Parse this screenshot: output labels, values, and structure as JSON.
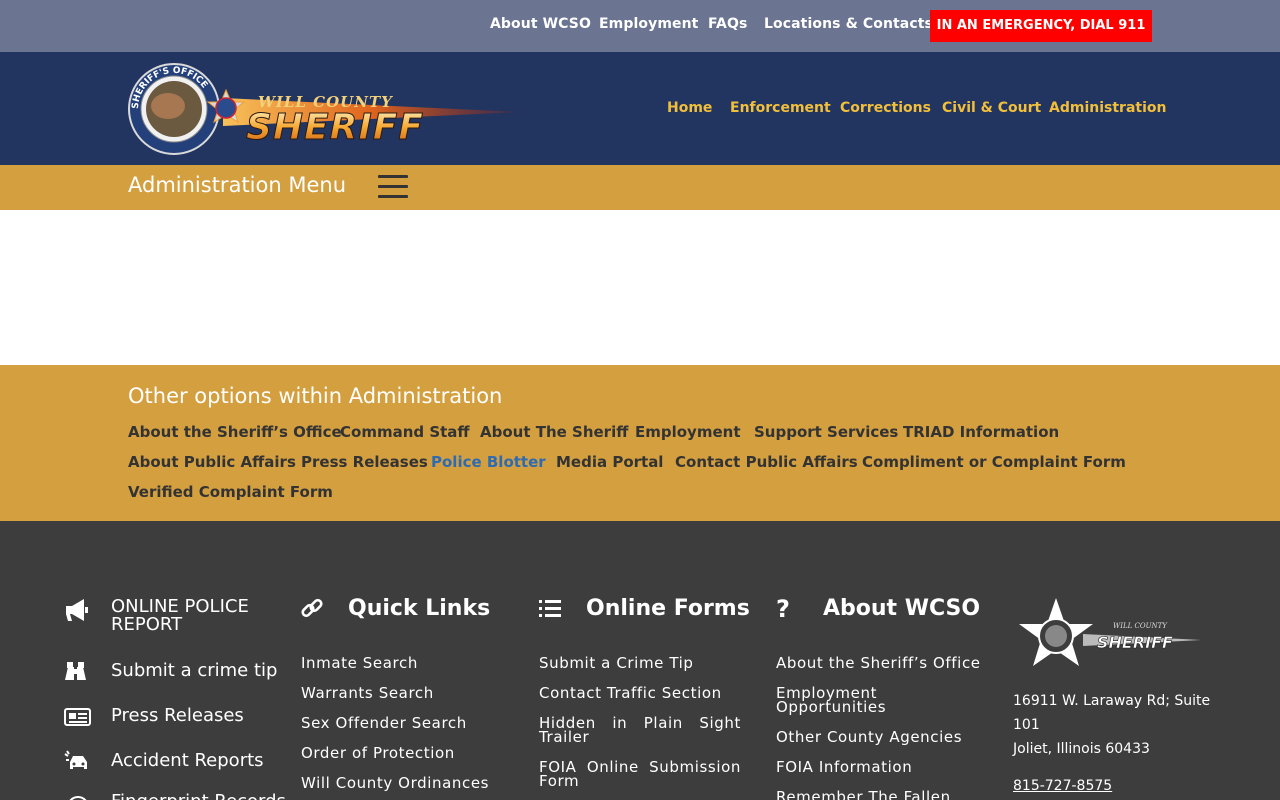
{
  "topbar": {
    "links": [
      "About WCSO",
      "Employment",
      "FAQs",
      "Locations & Contacts"
    ],
    "emergency": "IN AN EMERGENCY, DIAL 911",
    "emergency_color": "#ff0000"
  },
  "header": {
    "logo": {
      "seal_text": "SHERIFF'S OFFICE WILL COUNTY",
      "small": "WILL COUNTY",
      "big": "SHERIFF"
    },
    "nav": [
      "Home",
      "Enforcement",
      "Corrections",
      "Civil & Court",
      "Administration"
    ],
    "nav_color": "#f2bf3b",
    "bg_color": "#223560"
  },
  "admin_menu": {
    "title": "Administration Menu",
    "bg_color": "#d49f3f"
  },
  "other_options": {
    "title": "Other options within Administration",
    "links": [
      "About the Sheriff’s Office",
      "Command Staff",
      "About The Sheriff",
      "Employment",
      "Support Services",
      "TRIAD Information",
      "About Public Affairs",
      "Press Releases",
      "Police Blotter",
      "Media Portal",
      "Contact Public Affairs",
      "Compliment or Complaint Form",
      "Verified Complaint Form"
    ],
    "active": "Police Blotter",
    "active_color": "#2e6bb0"
  },
  "footer": {
    "quick_actions": [
      {
        "icon": "megaphone-icon",
        "label": "ONLINE POLICE REPORT"
      },
      {
        "icon": "binoculars-icon",
        "label": "Submit a crime tip"
      },
      {
        "icon": "newspaper-icon",
        "label": "Press Releases"
      },
      {
        "icon": "car-crash-icon",
        "label": "Accident Reports"
      },
      {
        "icon": "fingerprint-icon",
        "label": "Fingerprint Records"
      }
    ],
    "quick_links": {
      "heading": "Quick Links",
      "items": [
        "Inmate Search",
        "Warrants Search",
        "Sex Offender Search",
        "Order of Protection",
        "Will County Ordinances"
      ]
    },
    "online_forms": {
      "heading": "Online Forms",
      "items": [
        "Submit a Crime Tip",
        "Contact Traffic Section",
        "Hidden in Plain Sight Trailer",
        "FOIA Online Submission Form"
      ]
    },
    "about": {
      "heading": "About WCSO",
      "items": [
        "About the Sheriff’s Office",
        "Employment Opportunities",
        "Other County Agencies",
        "FOIA Information",
        "Remember The Fallen"
      ]
    },
    "contact": {
      "logo_small": "WILL COUNTY",
      "logo_big": "SHERIFF",
      "address_line1": "16911 W. Laraway Rd; Suite",
      "address_line2": "101",
      "address_line3": "Joliet, Illinois 60433",
      "phone": "815-727-8575"
    },
    "bg_color": "#3d3d3d"
  }
}
